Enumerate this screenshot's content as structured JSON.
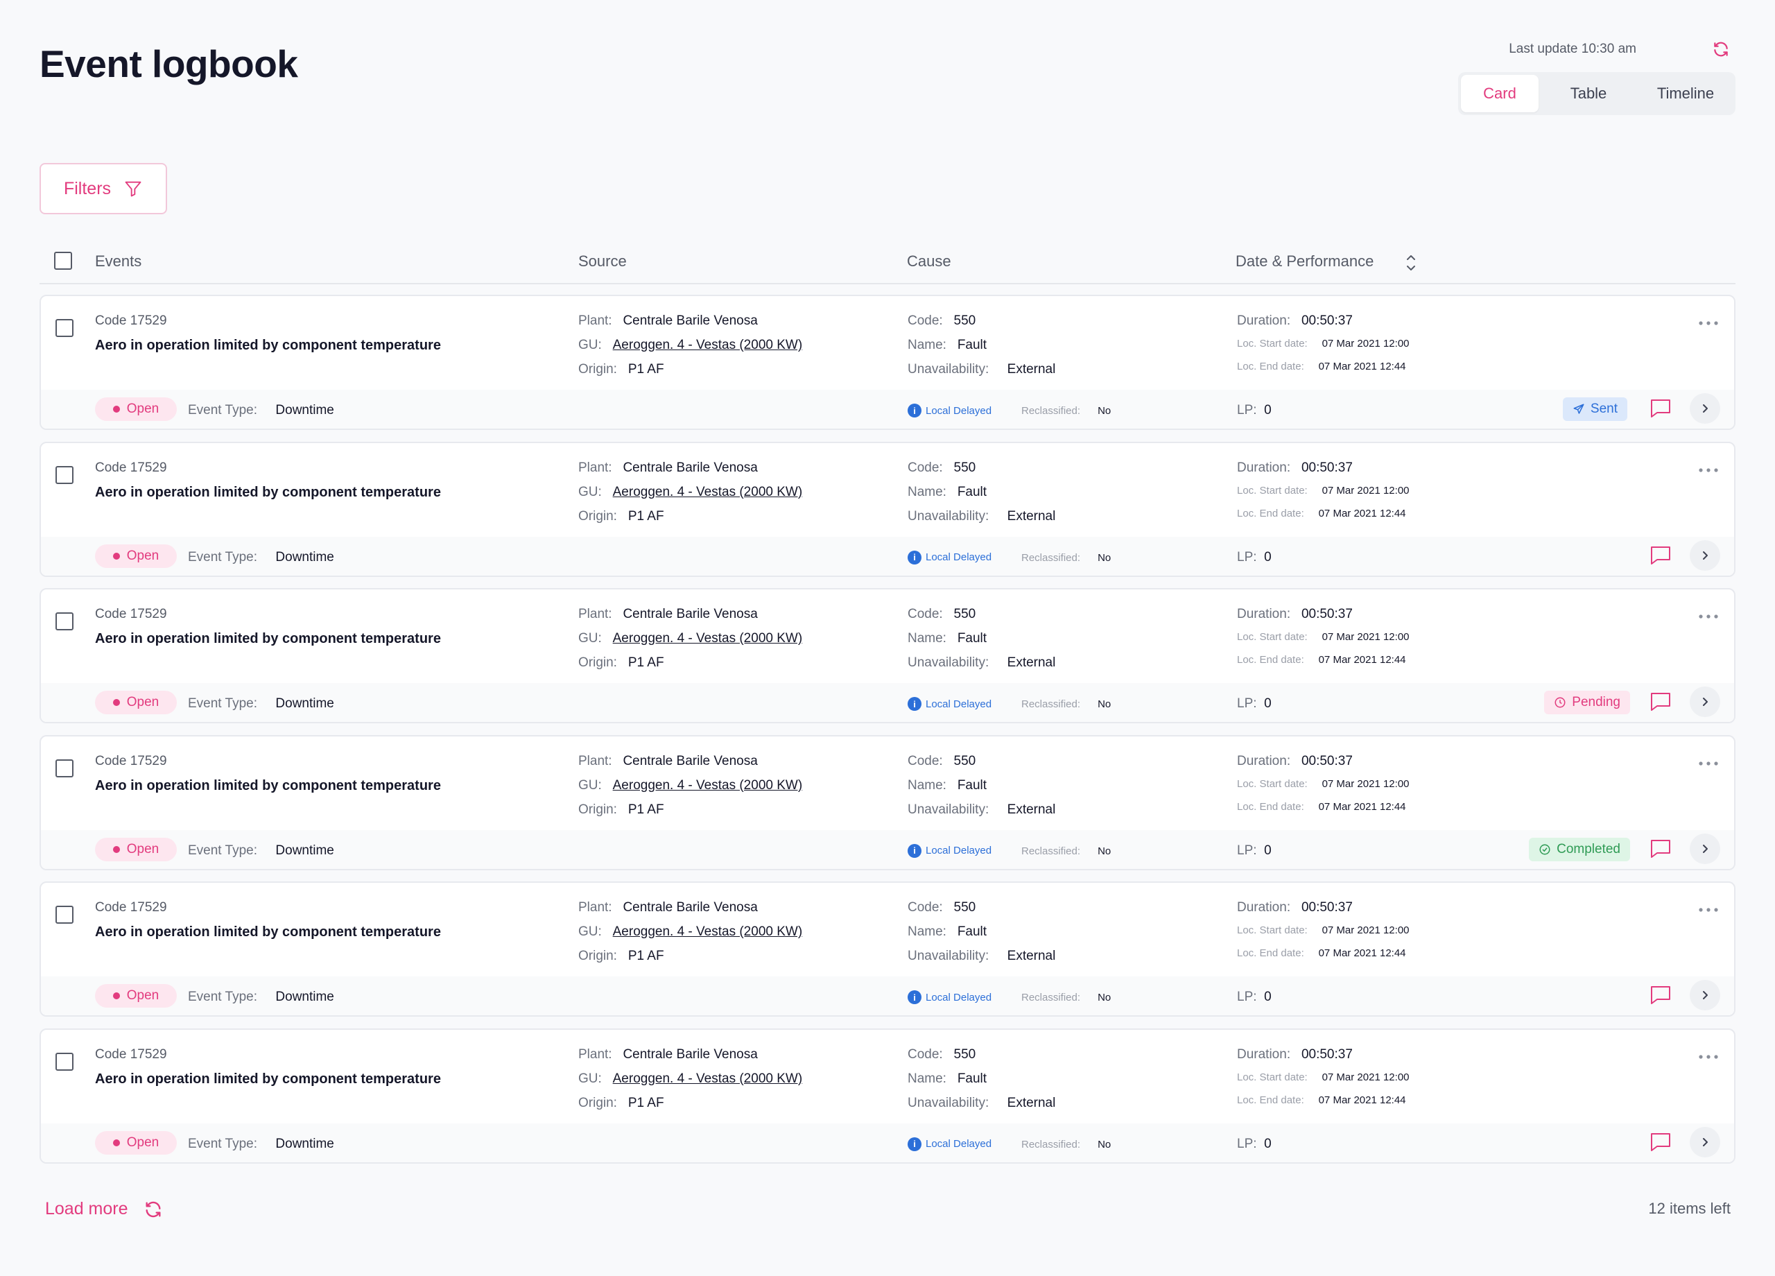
{
  "page": {
    "title": "Event logbook"
  },
  "header": {
    "last_update": "Last update 10:30 am"
  },
  "view_tabs": [
    "Card",
    "Table",
    "Timeline"
  ],
  "active_view": "Card",
  "filters": {
    "label": "Filters"
  },
  "columns": [
    "Events",
    "Source",
    "Cause",
    "Date & Performance"
  ],
  "labels": {
    "plant": "Plant:",
    "gu": "GU:",
    "origin": "Origin:",
    "code": "Code:",
    "name": "Name:",
    "unavailability": "Unavailability:",
    "duration": "Duration:",
    "loc_start": "Loc. Start date:",
    "loc_end": "Loc. End date:",
    "event_type": "Event Type:",
    "reclassified": "Reclassified:",
    "lp": "LP:"
  },
  "events": [
    {
      "code": "Code 17529",
      "title": "Aero in operation limited by component temperature",
      "plant": "Centrale Barile Venosa",
      "gu": "Aeroggen. 4 - Vestas (2000 KW)",
      "origin": "P1 AF",
      "cause_code": "550",
      "cause_name": "Fault",
      "unavailability": "External",
      "duration": "00:50:37",
      "start": "07 Mar 2021 12:00",
      "end": "07 Mar 2021 12:44",
      "status": "Open",
      "event_type": "Downtime",
      "local_delayed": "Local Delayed",
      "reclassified": "No",
      "lp": "0",
      "badge": "Sent"
    },
    {
      "code": "Code 17529",
      "title": "Aero in operation limited by component temperature",
      "plant": "Centrale Barile Venosa",
      "gu": "Aeroggen. 4 - Vestas (2000 KW)",
      "origin": "P1 AF",
      "cause_code": "550",
      "cause_name": "Fault",
      "unavailability": "External",
      "duration": "00:50:37",
      "start": "07 Mar 2021 12:00",
      "end": "07 Mar 2021 12:44",
      "status": "Open",
      "event_type": "Downtime",
      "local_delayed": "Local Delayed",
      "reclassified": "No",
      "lp": "0",
      "badge": ""
    },
    {
      "code": "Code 17529",
      "title": "Aero in operation limited by component temperature",
      "plant": "Centrale Barile Venosa",
      "gu": "Aeroggen. 4 - Vestas (2000 KW)",
      "origin": "P1 AF",
      "cause_code": "550",
      "cause_name": "Fault",
      "unavailability": "External",
      "duration": "00:50:37",
      "start": "07 Mar 2021 12:00",
      "end": "07 Mar 2021 12:44",
      "status": "Open",
      "event_type": "Downtime",
      "local_delayed": "Local Delayed",
      "reclassified": "No",
      "lp": "0",
      "badge": "Pending"
    },
    {
      "code": "Code 17529",
      "title": "Aero in operation limited by component temperature",
      "plant": "Centrale Barile Venosa",
      "gu": "Aeroggen. 4 - Vestas (2000 KW)",
      "origin": "P1 AF",
      "cause_code": "550",
      "cause_name": "Fault",
      "unavailability": "External",
      "duration": "00:50:37",
      "start": "07 Mar 2021 12:00",
      "end": "07 Mar 2021 12:44",
      "status": "Open",
      "event_type": "Downtime",
      "local_delayed": "Local Delayed",
      "reclassified": "No",
      "lp": "0",
      "badge": "Completed"
    },
    {
      "code": "Code 17529",
      "title": "Aero in operation limited by component temperature",
      "plant": "Centrale Barile Venosa",
      "gu": "Aeroggen. 4 - Vestas (2000 KW)",
      "origin": "P1 AF",
      "cause_code": "550",
      "cause_name": "Fault",
      "unavailability": "External",
      "duration": "00:50:37",
      "start": "07 Mar 2021 12:00",
      "end": "07 Mar 2021 12:44",
      "status": "Open",
      "event_type": "Downtime",
      "local_delayed": "Local Delayed",
      "reclassified": "No",
      "lp": "0",
      "badge": ""
    },
    {
      "code": "Code 17529",
      "title": "Aero in operation limited by component temperature",
      "plant": "Centrale Barile Venosa",
      "gu": "Aeroggen. 4 - Vestas (2000 KW)",
      "origin": "P1 AF",
      "cause_code": "550",
      "cause_name": "Fault",
      "unavailability": "External",
      "duration": "00:50:37",
      "start": "07 Mar 2021 12:00",
      "end": "07 Mar 2021 12:44",
      "status": "Open",
      "event_type": "Downtime",
      "local_delayed": "Local Delayed",
      "reclassified": "No",
      "lp": "0",
      "badge": ""
    }
  ],
  "footer": {
    "load_more": "Load more",
    "items_left": "12 items left"
  },
  "colors": {
    "accent": "#e23b7e",
    "info": "#2c6fd8",
    "success": "#2f9b55"
  }
}
